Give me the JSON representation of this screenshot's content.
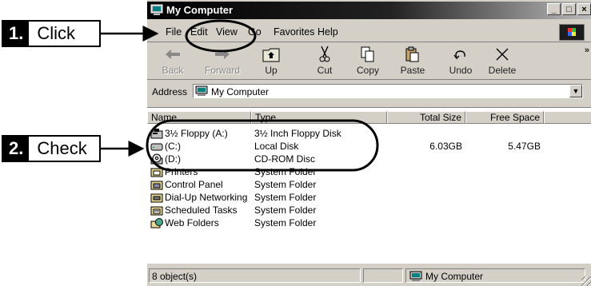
{
  "window": {
    "title": "My Computer"
  },
  "menu": [
    {
      "label": "File"
    },
    {
      "label": "Edit"
    },
    {
      "label": "View"
    },
    {
      "label": "Go"
    },
    {
      "label": "Favorites"
    },
    {
      "label": "Help"
    }
  ],
  "toolbar": {
    "back": "Back",
    "forward": "Forward",
    "up": "Up",
    "cut": "Cut",
    "copy": "Copy",
    "paste": "Paste",
    "undo": "Undo",
    "delete": "Delete",
    "more": "»"
  },
  "address": {
    "label": "Address",
    "value": "My Computer"
  },
  "columns": {
    "name": "Name",
    "type": "Type",
    "total": "Total Size",
    "free": "Free Space"
  },
  "items": [
    {
      "name": "3½ Floppy (A:)",
      "type": "3½ Inch Floppy Disk",
      "total": "",
      "free": "",
      "icon": "floppy-drive-icon"
    },
    {
      "name": "(C:)",
      "type": "Local Disk",
      "total": "6.03GB",
      "free": "5.47GB",
      "icon": "hard-disk-icon"
    },
    {
      "name": "(D:)",
      "type": "CD-ROM Disc",
      "total": "",
      "free": "",
      "icon": "cdrom-drive-icon"
    },
    {
      "name": "Printers",
      "type": "System Folder",
      "total": "",
      "free": "",
      "icon": "printers-folder-icon"
    },
    {
      "name": "Control Panel",
      "type": "System Folder",
      "total": "",
      "free": "",
      "icon": "control-panel-icon"
    },
    {
      "name": "Dial-Up Networking",
      "type": "System Folder",
      "total": "",
      "free": "",
      "icon": "dialup-networking-icon"
    },
    {
      "name": "Scheduled Tasks",
      "type": "System Folder",
      "total": "",
      "free": "",
      "icon": "scheduled-tasks-icon"
    },
    {
      "name": "Web Folders",
      "type": "System Folder",
      "total": "",
      "free": "",
      "icon": "web-folders-icon"
    }
  ],
  "status": {
    "count": "8 object(s)",
    "location": "My Computer"
  },
  "callouts": [
    {
      "num": "1.",
      "text": "Click"
    },
    {
      "num": "2.",
      "text": "Check"
    }
  ]
}
